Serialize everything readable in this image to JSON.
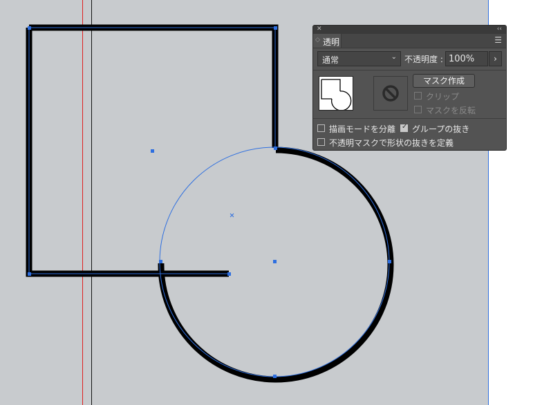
{
  "panel": {
    "close_icon": "close-icon",
    "collapse_icon": "collapse-double-chevron-icon",
    "tab_label": "透明",
    "menu_icon": "panel-menu-icon",
    "blend_mode": "通常",
    "opacity_label": "不透明度 :",
    "opacity_value": "100%",
    "opacity_arrow": "›",
    "make_mask_button": "マスク作成",
    "clip_label": "クリップ",
    "invert_mask_label": "マスクを反転",
    "isolate_blending_label": "描画モードを分離",
    "knockout_group_label": "グループの抜き",
    "opacity_mask_label": "不透明マスクで形状の抜きを定義",
    "checkboxes": {
      "clip": false,
      "invert_mask": false,
      "isolate_blending": false,
      "knockout_group": true,
      "opacity_mask_knockout": false
    }
  },
  "colors": {
    "canvas": "#c8cbce",
    "selection": "#2e6fe0",
    "guide_red": "#e02020",
    "panel_bg": "#535353",
    "stroke": "#000000"
  }
}
